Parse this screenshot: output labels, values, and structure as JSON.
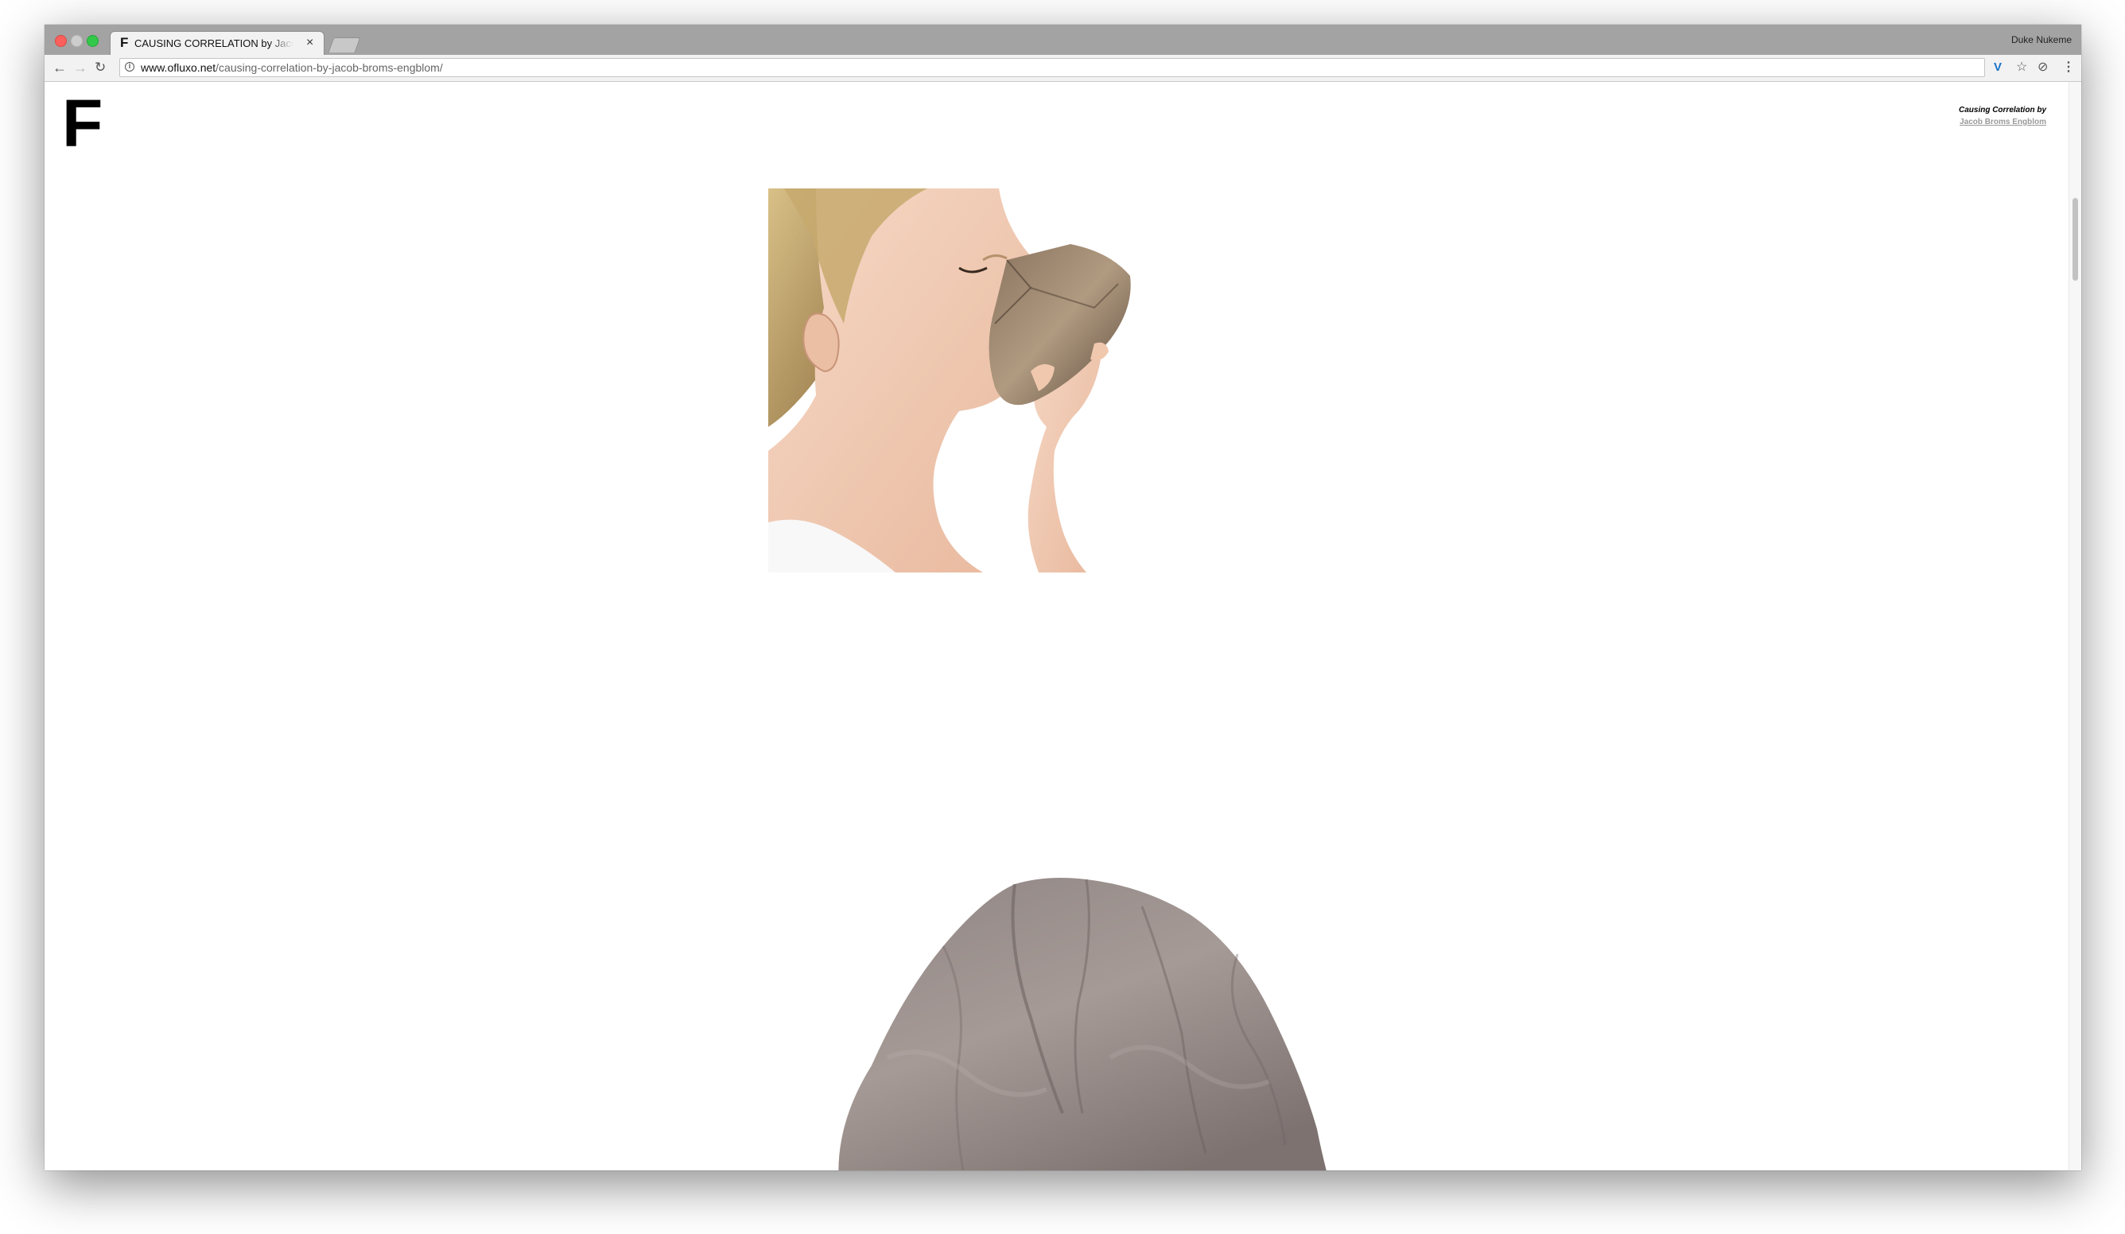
{
  "browser": {
    "tab_favicon": "F",
    "tab_title": "CAUSING CORRELATION by Jacob Broms Engblom",
    "tab_close": "×",
    "profile_name": "Duke Nukeme",
    "url_host": "www.ofluxo.net",
    "url_path": "/causing-correlation-by-jacob-broms-engblom/",
    "icons": [
      "back-arrow-icon",
      "forward-arrow-icon",
      "reload-icon",
      "info-icon",
      "extension-icon",
      "bookmark-star-icon",
      "extension-2-icon",
      "menu-dots-icon"
    ]
  },
  "page": {
    "logo": "F",
    "credit_title": "Causing Correlation by",
    "credit_author": "Jacob Broms Engblom",
    "images": [
      {
        "name": "woman-smelling-rock-photo"
      },
      {
        "name": "large-boulder-photo"
      }
    ]
  },
  "colors": {
    "tabstrip": "#a3a3a3",
    "toolbar": "#f2f2f2",
    "extension_accent": "#1a73c8"
  }
}
